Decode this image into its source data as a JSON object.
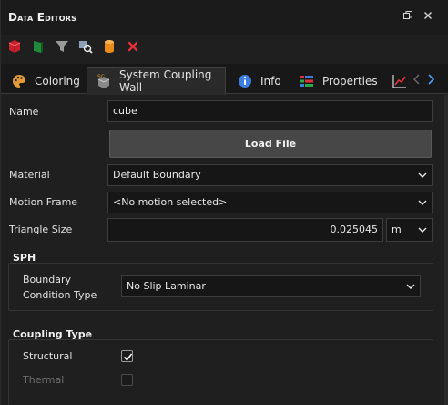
{
  "window": {
    "title": "Data Editors",
    "float_icon": "float-window-icon",
    "close_icon": "close-icon"
  },
  "toolbar": {
    "icons": [
      "red-cube-icon",
      "green-flag-icon",
      "filter-icon",
      "search-settings-icon",
      "cylinder-icon",
      "delete-x-icon"
    ]
  },
  "tabs": [
    {
      "label": "Coloring",
      "icon": "palette-icon"
    },
    {
      "label": "System Coupling Wall",
      "icon": "sc-wall-icon"
    },
    {
      "label": "Info",
      "icon": "info-icon"
    },
    {
      "label": "Properties",
      "icon": "properties-icon"
    },
    {
      "label": "",
      "icon": "chart-icon"
    }
  ],
  "active_tab": "System Coupling Wall",
  "form": {
    "name_label": "Name",
    "name_value": "cube",
    "load_file_label": "Load File",
    "material_label": "Material",
    "material_value": "Default Boundary",
    "motion_frame_label": "Motion Frame",
    "motion_frame_value": "<No motion selected>",
    "triangle_size_label": "Triangle Size",
    "triangle_size_value": "0.025045",
    "triangle_size_unit": "m"
  },
  "sph": {
    "title": "SPH",
    "bc_label_line1": "Boundary",
    "bc_label_line2": "Condition Type",
    "bc_value": "No Slip Laminar"
  },
  "coupling": {
    "title": "Coupling Type",
    "structural_label": "Structural",
    "structural_checked": true,
    "thermal_label": "Thermal",
    "thermal_checked": false,
    "thermal_enabled": false
  },
  "colors": {
    "background": "#1f1f1f",
    "field_bg": "#161616",
    "button_bg": "#474747",
    "accent_red": "#e0323a",
    "accent_blue": "#3a7fe0"
  }
}
